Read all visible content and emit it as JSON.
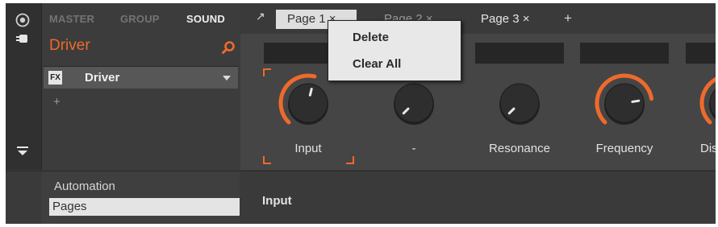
{
  "browser_tabs": {
    "master": "MASTER",
    "group": "GROUP",
    "sound": "SOUND"
  },
  "sound": {
    "name": "Driver"
  },
  "slot": {
    "fx_badge": "FX",
    "plugin_name": "Driver",
    "add_label": "+"
  },
  "pages": {
    "expand_icon": "↗",
    "tabs": [
      {
        "label": "Page 1 ×"
      },
      {
        "label": "Page 2 ×"
      },
      {
        "label": "Page 3 ×"
      }
    ],
    "add_label": "+"
  },
  "parameters": [
    {
      "label": "Input",
      "value": 0.55,
      "focused": true
    },
    {
      "label": "-",
      "value": 0.0
    },
    {
      "label": "Resonance",
      "value": 0.0
    },
    {
      "label": "Frequency",
      "value": 0.8
    },
    {
      "label": "Dist",
      "value": 0.5
    }
  ],
  "bottom": {
    "automation_label": "Automation",
    "pages_field_value": "Pages",
    "selected_param": "Input"
  },
  "context_menu": {
    "items": [
      "Delete",
      "Clear All"
    ]
  },
  "colors": {
    "accent": "#ee6a2c",
    "panel": "#3a3a3a",
    "knob": "#2e2e2e",
    "menu_bg": "#e8e8e8"
  }
}
